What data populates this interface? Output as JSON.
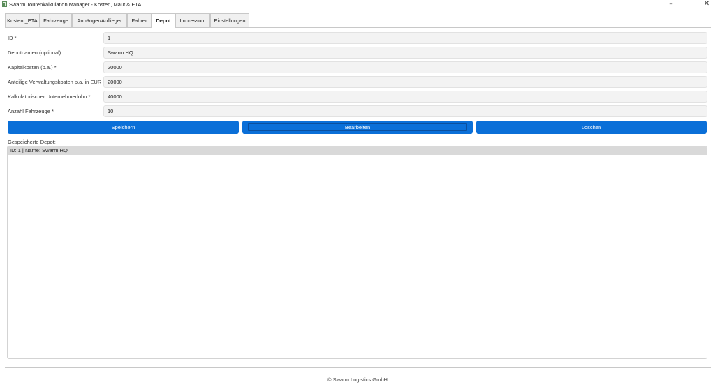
{
  "window": {
    "title": "Swarm Tourenkalkulation Manager - Kosten, Maut & ETA",
    "minimize": "–",
    "close": "✕"
  },
  "tabs": [
    {
      "label": "Kosten _ETA"
    },
    {
      "label": "Fahrzeuge"
    },
    {
      "label": "Anhänger/Auflieger"
    },
    {
      "label": "Fahrer"
    },
    {
      "label": "Depot"
    },
    {
      "label": "Impressum"
    },
    {
      "label": "Einstellungen"
    }
  ],
  "active_tab": "Depot",
  "form": {
    "id": {
      "label": "ID *",
      "value": "1"
    },
    "name": {
      "label": "Depotnamen (optional)",
      "value": "Swarm HQ"
    },
    "capital": {
      "label": "Kapitalkosten (p.a.) *",
      "value": "20000"
    },
    "admin": {
      "label": "Anteilige Verwaltungskosten p.a. in EUR *",
      "value": "20000"
    },
    "wage": {
      "label": "Kalkulatorischer Unternehmerlohn *",
      "value": "40000"
    },
    "vehicles": {
      "label": "Anzahl Fahrzeuge *",
      "value": "10"
    }
  },
  "buttons": {
    "save": "Speichern",
    "edit": "Bearbeiten",
    "delete": "Löschen"
  },
  "saved": {
    "title": "Gespeicherte Depot:",
    "items": [
      {
        "text": "ID: 1 | Name: Swarm HQ"
      }
    ]
  },
  "footer": {
    "text": "© Swarm Logistics GmbH"
  },
  "colors": {
    "accent": "#0a6fd8",
    "selected_row": "#d9d9d9"
  }
}
